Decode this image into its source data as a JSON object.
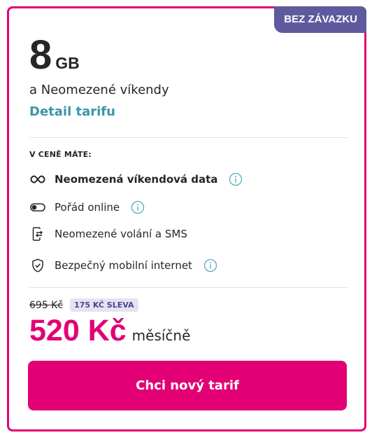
{
  "badge": "BEZ ZÁVAZKU",
  "plan": {
    "data_amount": "8",
    "data_unit": "GB",
    "subtitle": "a Neomezené víkendy",
    "detail_link": "Detail tarifu"
  },
  "features": {
    "section_label": "V CENĚ MÁTE:",
    "items": [
      {
        "icon": "infinity-icon",
        "label": "Neomezená víkendová data",
        "bold": true,
        "has_info": true
      },
      {
        "icon": "toggle-icon",
        "label": "Pořád online",
        "bold": false,
        "has_info": true
      },
      {
        "icon": "phone-transfer-icon",
        "label": "Neomezené volání a SMS",
        "bold": false,
        "has_info": false
      },
      {
        "icon": "shield-icon",
        "label": "Bezpečný mobilní internet",
        "bold": false,
        "has_info": true
      }
    ]
  },
  "pricing": {
    "old_price": "695 Kč",
    "discount": "175 KČ SLEVA",
    "current_price": "520 Kč",
    "period": "měsíčně"
  },
  "cta": {
    "label": "Chci nový tarif"
  },
  "colors": {
    "brand": "#e20074",
    "badge": "#5f5a9e",
    "link": "#3a95aa",
    "info": "#5aa9c4"
  }
}
